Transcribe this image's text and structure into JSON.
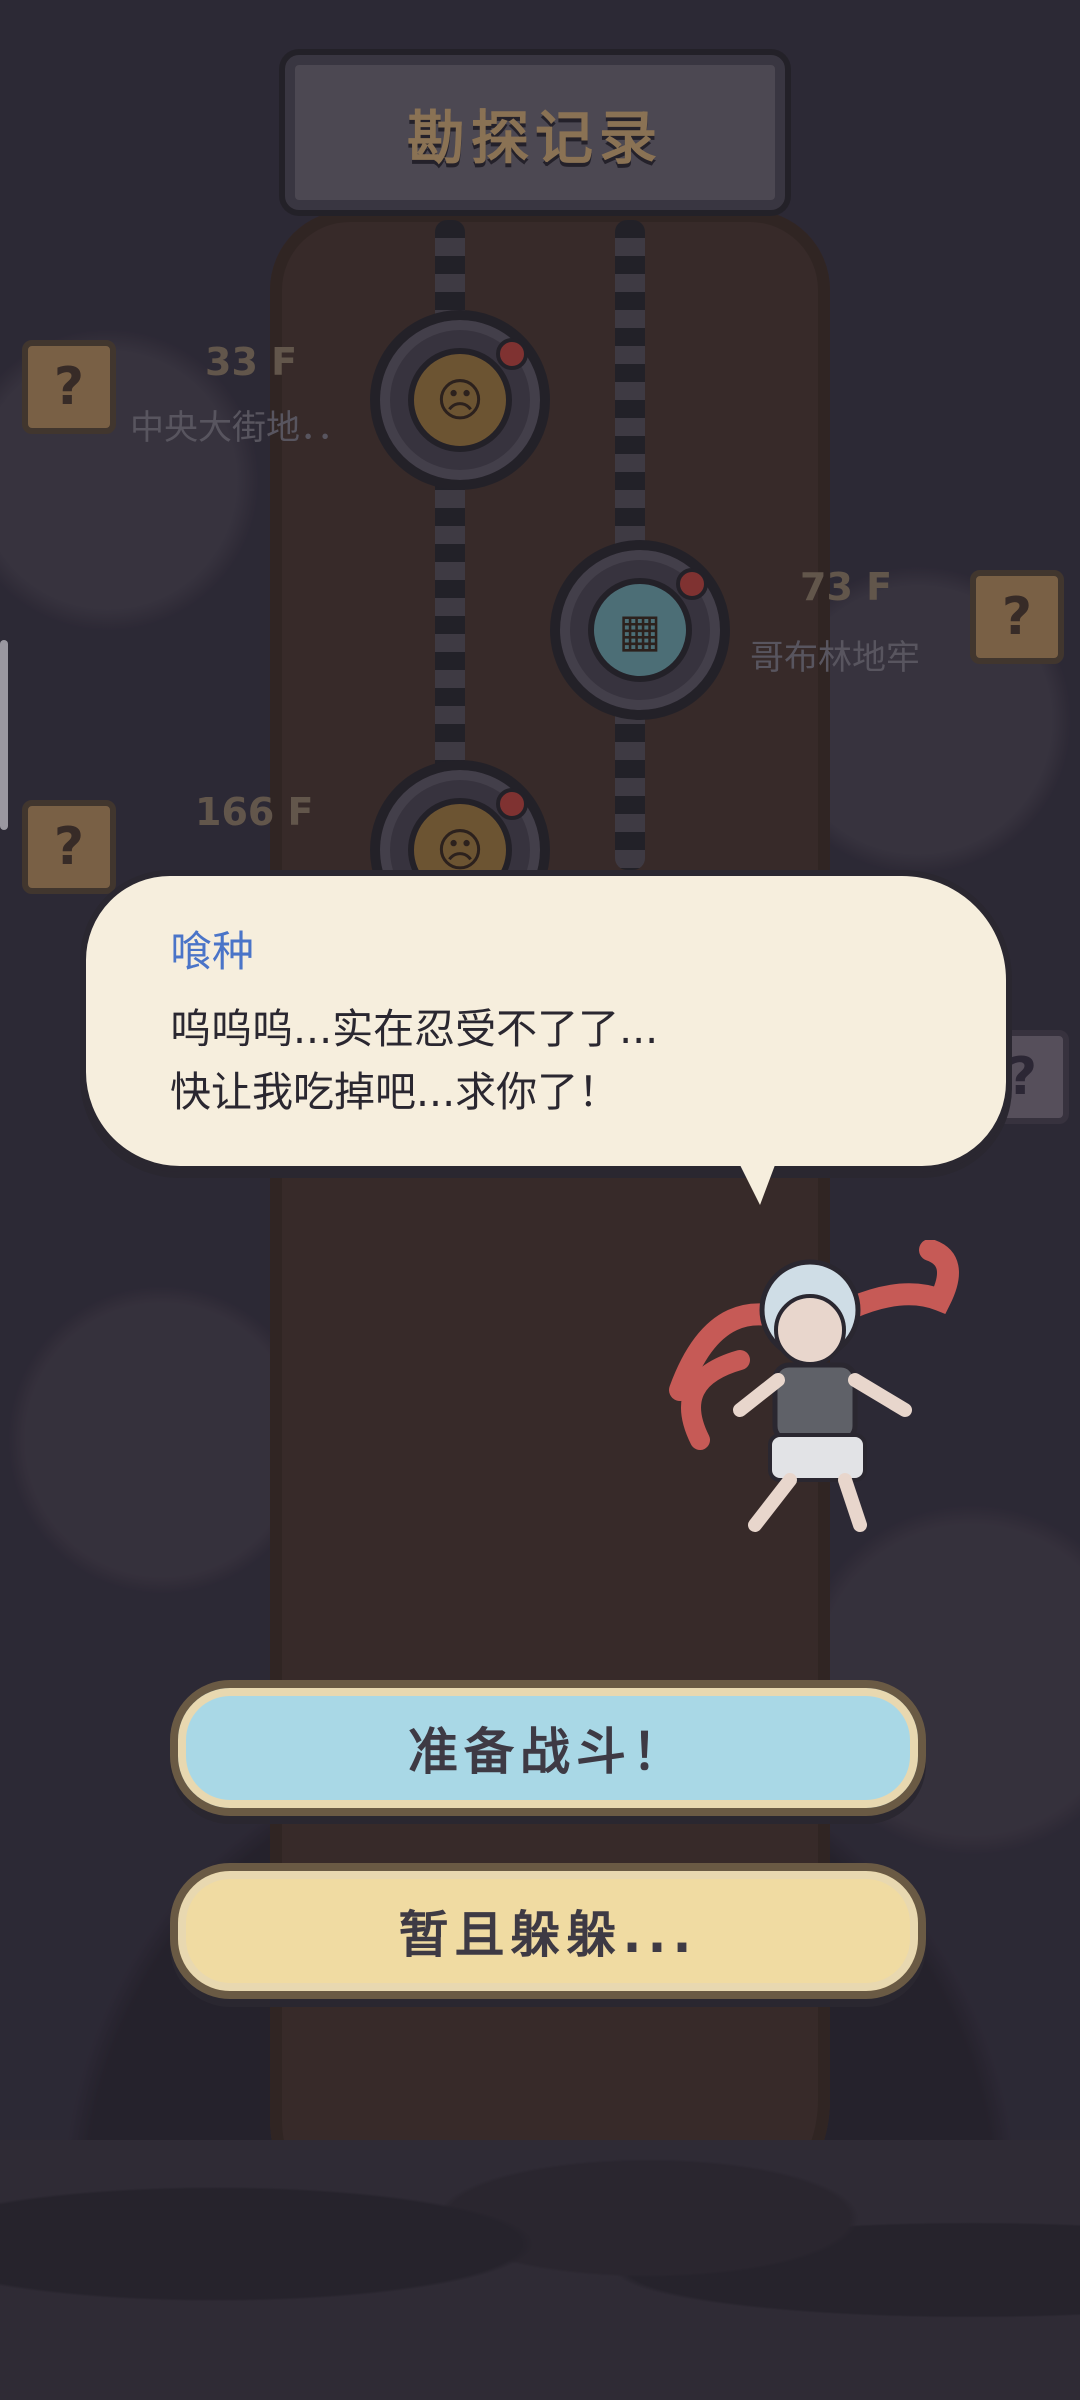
{
  "header": {
    "title": "勘探记录"
  },
  "map": {
    "floors": [
      {
        "floor": "33 F",
        "place": "中央大街地．．",
        "side": "left"
      },
      {
        "floor": "73 F",
        "place": "哥布林地牢",
        "side": "right"
      },
      {
        "floor": "166 F",
        "place": "",
        "side": "left"
      }
    ],
    "unknown_marker": "?"
  },
  "dialog": {
    "speaker": "喰种",
    "lines": [
      "呜呜呜...实在忍受不了了...",
      "快让我吃掉吧...求你了！"
    ]
  },
  "actions": {
    "fight_label": "准备战斗！",
    "hide_label": "暂且躲躲..."
  },
  "colors": {
    "speaker": "#4a74c8",
    "fight_button": "#a9d8e6",
    "hide_button": "#f0dba2"
  }
}
